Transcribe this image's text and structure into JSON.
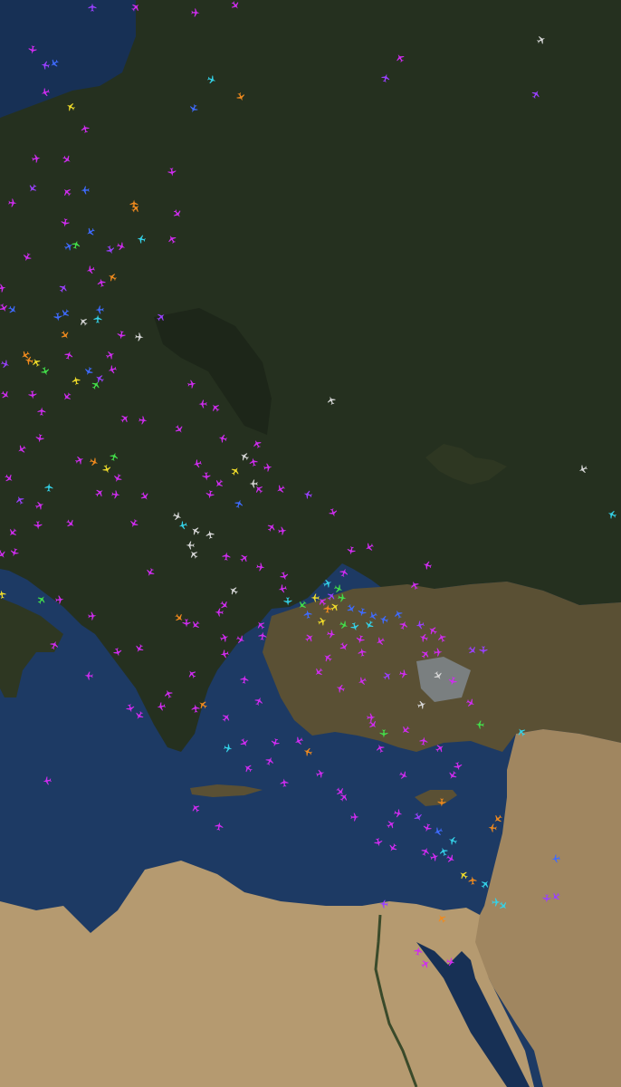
{
  "colors": {
    "sea": "#1d3a64",
    "sea_deep": "#173055",
    "land_forest": "#25301f",
    "land_steppe": "#2e3722",
    "land_dry": "#5a5034",
    "desert": "#a08660",
    "desert_light": "#b59a70",
    "mountain_snow": "#7a7f80"
  },
  "traffic": {
    "icon": "airplane-icon",
    "colors": {
      "magenta": "#d02cf0",
      "violet": "#9a40ff",
      "blue": "#3f6bff",
      "cyan": "#34d2e8",
      "green": "#43e04a",
      "yellow": "#f0dc2a",
      "orange": "#f08a1e",
      "white": "#d8d8d8"
    }
  }
}
